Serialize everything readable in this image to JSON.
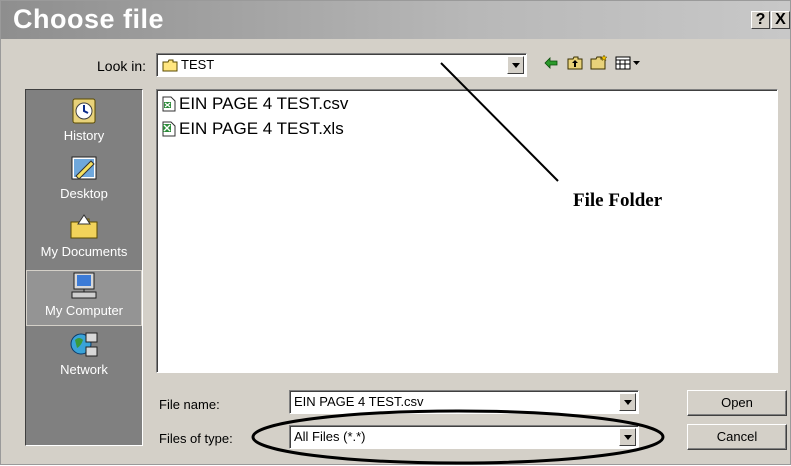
{
  "window": {
    "title": "Choose file",
    "help_label": "?",
    "close_label": "X"
  },
  "look_in": {
    "label": "Look in:",
    "value": "TEST"
  },
  "toolbar": {
    "icons": [
      "back-icon",
      "up-folder-icon",
      "new-folder-icon",
      "view-menu-icon"
    ]
  },
  "places": [
    {
      "label": "History",
      "icon": "history-icon"
    },
    {
      "label": "Desktop",
      "icon": "desktop-icon"
    },
    {
      "label": "My Documents",
      "icon": "my-documents-icon"
    },
    {
      "label": "My Computer",
      "icon": "my-computer-icon"
    },
    {
      "label": "Network",
      "icon": "network-icon"
    }
  ],
  "files": [
    {
      "name": "EIN PAGE 4 TEST.csv",
      "icon": "csv-file-icon"
    },
    {
      "name": "EIN PAGE 4 TEST.xls",
      "icon": "excel-file-icon"
    }
  ],
  "file_name": {
    "label": "File name:",
    "value": "EIN PAGE 4 TEST.csv"
  },
  "file_type": {
    "label": "Files of type:",
    "value": "All Files (*.*)"
  },
  "buttons": {
    "open": "Open",
    "cancel": "Cancel"
  },
  "annotation": {
    "text": "File Folder"
  }
}
